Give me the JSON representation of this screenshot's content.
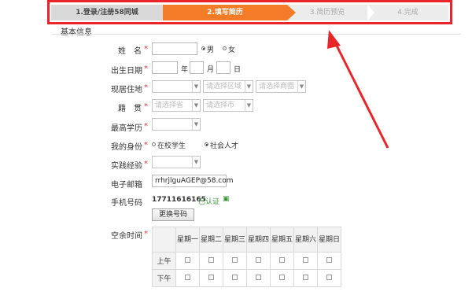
{
  "steps": [
    {
      "label": "1.登录/注册58同城"
    },
    {
      "label": "2.填写简历"
    },
    {
      "label": "3.简历预览"
    },
    {
      "label": "4.完成"
    }
  ],
  "section_title": "基本信息",
  "form": {
    "name_label": "姓　名",
    "gender_male": "男",
    "gender_female": "女",
    "birth_label": "出生日期",
    "year": "年",
    "month": "月",
    "day": "日",
    "residence_label": "现居住地",
    "residence_area_placeholder": "请选择区域",
    "residence_zone_placeholder": "请选择商圈",
    "hometown_label": "籍　贯",
    "hometown_province_placeholder": "请选择省",
    "hometown_city_placeholder": "请选择市",
    "education_label": "最高学历",
    "identity_label": "我的身份",
    "identity_student": "在校学生",
    "identity_social": "社会人才",
    "experience_label": "实践经验",
    "email_label": "电子邮箱",
    "email_value": "rrhrjlguAGEP@58.com",
    "phone_label": "手机号码",
    "phone_value": "17711616165",
    "verified_text": "已认证",
    "change_phone_button": "更换号码",
    "free_time_label": "空余时间"
  },
  "schedule": {
    "days": [
      "星期一",
      "星期二",
      "星期三",
      "星期四",
      "星期五",
      "星期六",
      "星期日"
    ],
    "rows": [
      "上午",
      "下午"
    ]
  },
  "colors": {
    "annotation_red": "#e8262a",
    "active_step": "#f47b27"
  }
}
